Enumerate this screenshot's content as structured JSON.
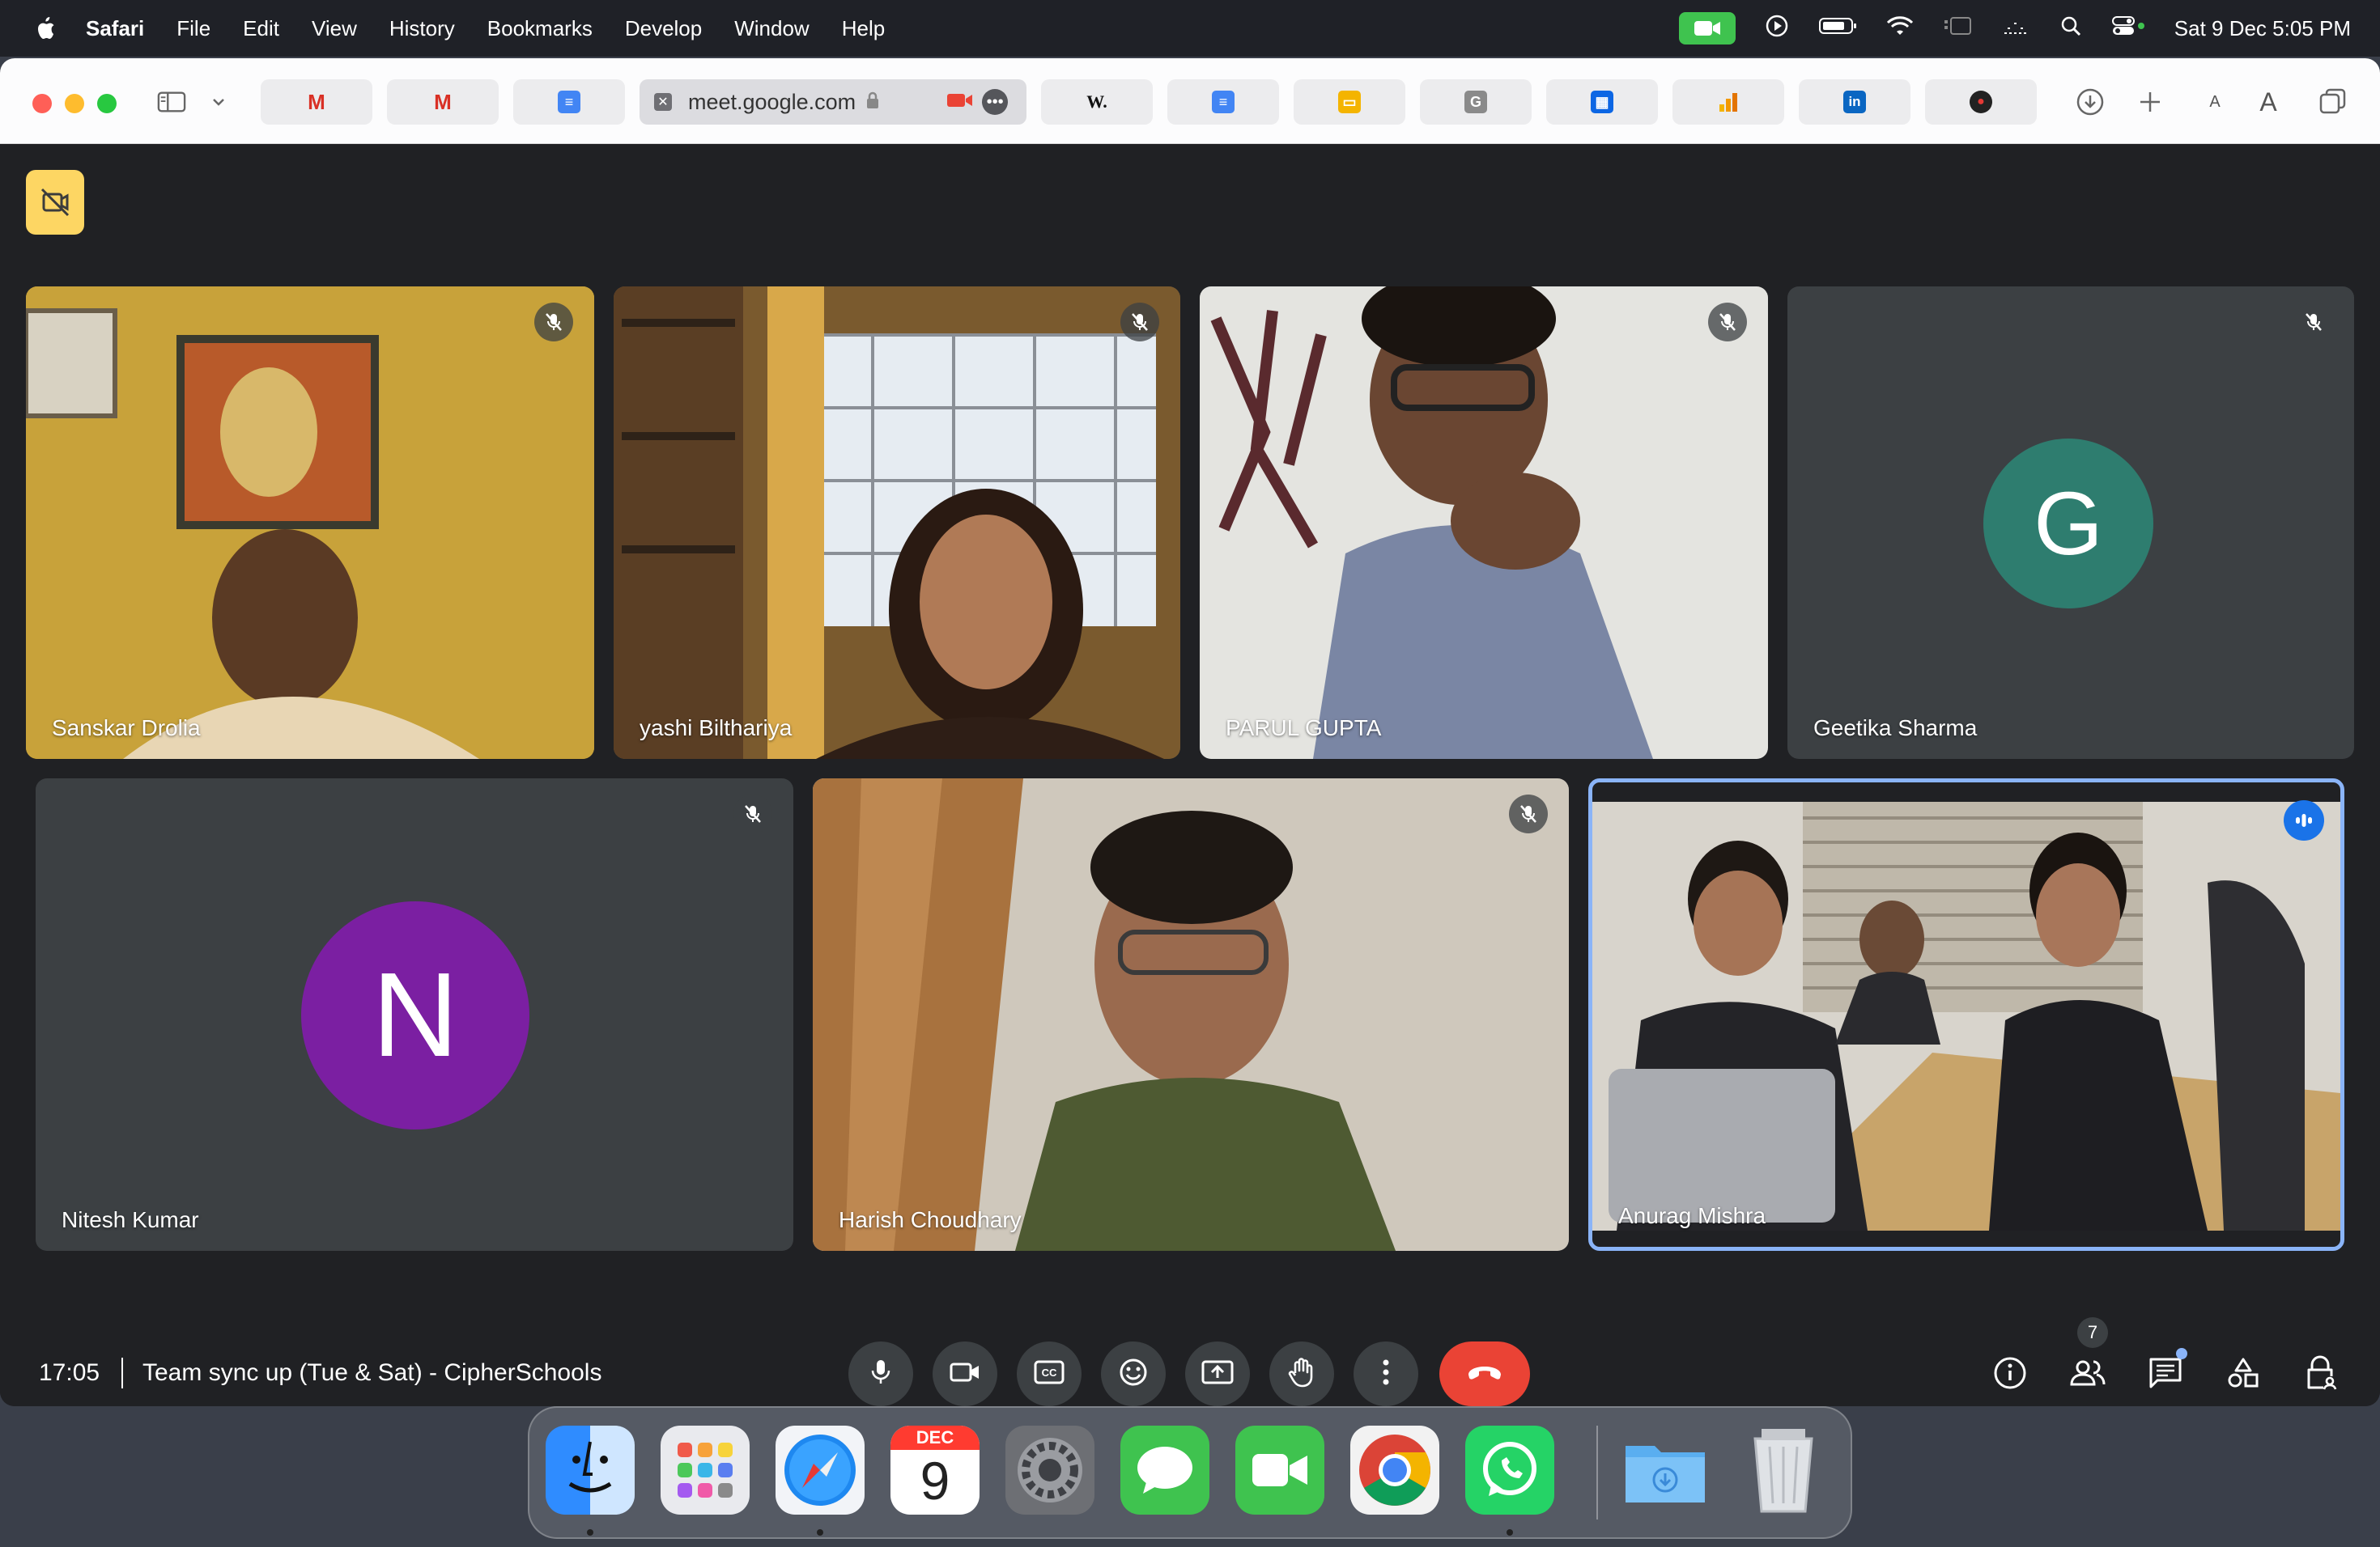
{
  "menubar": {
    "app_name": "Safari",
    "items": [
      "File",
      "Edit",
      "View",
      "History",
      "Bookmarks",
      "Develop",
      "Window",
      "Help"
    ],
    "clock": "Sat 9 Dec  5:05 PM"
  },
  "browser": {
    "active_tab": {
      "url": "meet.google.com"
    },
    "tabs": [
      {
        "icon": "gmail-icon",
        "glyph": "M"
      },
      {
        "icon": "gmail-icon",
        "glyph": "M"
      },
      {
        "icon": "google-docs-icon",
        "glyph": "≡"
      },
      {
        "icon": "wikipedia-icon",
        "glyph": "W."
      },
      {
        "icon": "google-docs-icon",
        "glyph": "≡"
      },
      {
        "icon": "google-slides-icon",
        "glyph": "▭"
      },
      {
        "icon": "g-letter-icon",
        "glyph": "G"
      },
      {
        "icon": "trello-icon",
        "glyph": "▦"
      },
      {
        "icon": "analytics-icon",
        "glyph": "▮"
      },
      {
        "icon": "linkedin-icon",
        "glyph": "in"
      },
      {
        "icon": "record-icon",
        "glyph": "●"
      }
    ],
    "text_size_small": "A",
    "text_size_large": "A"
  },
  "meet": {
    "participants": [
      {
        "name": "Sanskar Drolia",
        "video": true,
        "muted": true,
        "bg": "#c9a43a"
      },
      {
        "name": "yashi Bilthariya",
        "video": true,
        "muted": true,
        "bg": "#8a6a3a"
      },
      {
        "name": "PARUL GUPTA",
        "video": true,
        "muted": true,
        "bg": "#9aa3b5"
      },
      {
        "name": "Geetika Sharma",
        "video": false,
        "muted": true,
        "initial": "G",
        "avatar_color": "#2e7d6f"
      },
      {
        "name": "Nitesh Kumar",
        "video": false,
        "muted": true,
        "initial": "N",
        "avatar_color": "#7b1fa2"
      },
      {
        "name": "Harish Choudhary",
        "video": true,
        "muted": true,
        "bg": "#6c6a4a"
      },
      {
        "name": "Anurag Mishra",
        "video": true,
        "muted": false,
        "speaking": true,
        "bg": "#d7d3cc"
      }
    ],
    "meeting_time": "17:05",
    "meeting_title": "Team sync up (Tue & Sat) - CipherSchools",
    "people_count": "7",
    "colors": {
      "end_call": "#ea4335",
      "speaking_border": "#8ab4f8",
      "meet_bg": "#202124"
    }
  },
  "dock": {
    "apps": [
      "finder",
      "launchpad",
      "safari",
      "calendar",
      "system-settings",
      "messages",
      "facetime",
      "chrome",
      "whatsapp",
      "downloads",
      "trash"
    ],
    "calendar_month": "DEC",
    "calendar_day": "9"
  }
}
